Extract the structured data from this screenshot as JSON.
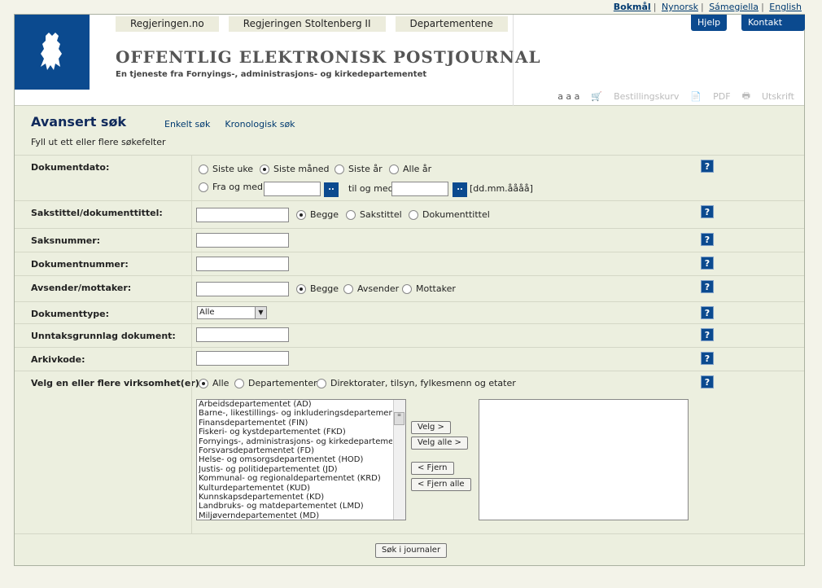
{
  "lang": [
    "Bokmål",
    "Nynorsk",
    "Sámegiella",
    "English"
  ],
  "topnav": [
    "Regjeringen.no",
    "Regjeringen Stoltenberg II",
    "Departementene"
  ],
  "site": {
    "title": "OFFENTLIG ELEKTRONISK POSTJOURNAL",
    "subtitle": "En tjeneste fra Fornyings-, administrasjons- og kirkedepartementet"
  },
  "header_buttons": {
    "help": "Hjelp",
    "contact": "Kontakt"
  },
  "tools": {
    "sizes": "a a a",
    "cart": "Bestillingskurv",
    "pdf": "PDF",
    "print": "Utskrift"
  },
  "page": {
    "title": "Avansert søk",
    "simple_search": "Enkelt søk",
    "chrono_search": "Kronologisk søk",
    "hint": "Fyll ut ett eller flere søkefelter"
  },
  "fields": {
    "doc_date": "Dokumentdato:",
    "title": "Sakstittel/dokumenttittel:",
    "case_no": "Saksnummer:",
    "doc_no": "Dokumentnummer:",
    "sender": "Avsender/mottaker:",
    "doc_type": "Dokumenttype:",
    "exempt": "Unntaksgrunnlag dokument:",
    "archive": "Arkivkode:",
    "org": "Velg en eller flere virksomhet(er):"
  },
  "date_opts": {
    "week": "Siste uke",
    "month": "Siste måned",
    "year": "Siste år",
    "all": "Alle år",
    "from": "Fra og med",
    "to": "til og med",
    "format": "[dd.mm.åååå]"
  },
  "title_opts": {
    "both": "Begge",
    "case": "Sakstittel",
    "doc": "Dokumenttittel"
  },
  "sender_opts": {
    "both": "Begge",
    "from": "Avsender",
    "to": "Mottaker"
  },
  "doc_type_value": "Alle",
  "org_opts": {
    "all": "Alle",
    "dept": "Departementer",
    "other": "Direktorater, tilsyn, fylkesmenn og etater"
  },
  "help_glyph": "?",
  "picker_glyph": "..",
  "departments": [
    "Arbeidsdepartementet (AD)",
    "Barne-, likestillings- og inkluderingsdepartementet (BL",
    "Finansdepartementet (FIN)",
    "Fiskeri- og kystdepartementet (FKD)",
    "Fornyings-, administrasjons- og kirkedepartementet (F",
    "Forsvarsdepartementet (FD)",
    "Helse- og omsorgsdepartementet (HOD)",
    "Justis- og politidepartementet (JD)",
    "Kommunal- og regionaldepartementet (KRD)",
    "Kulturdepartementet (KUD)",
    "Kunnskapsdepartementet (KD)",
    "Landbruks- og matdepartementet (LMD)",
    "Miljøverndepartementet (MD)"
  ],
  "list_buttons": {
    "select": "Velg >",
    "select_all": "Velg alle >",
    "remove": "< Fjern",
    "remove_all": "< Fjern alle"
  },
  "submit": "Søk i journaler"
}
